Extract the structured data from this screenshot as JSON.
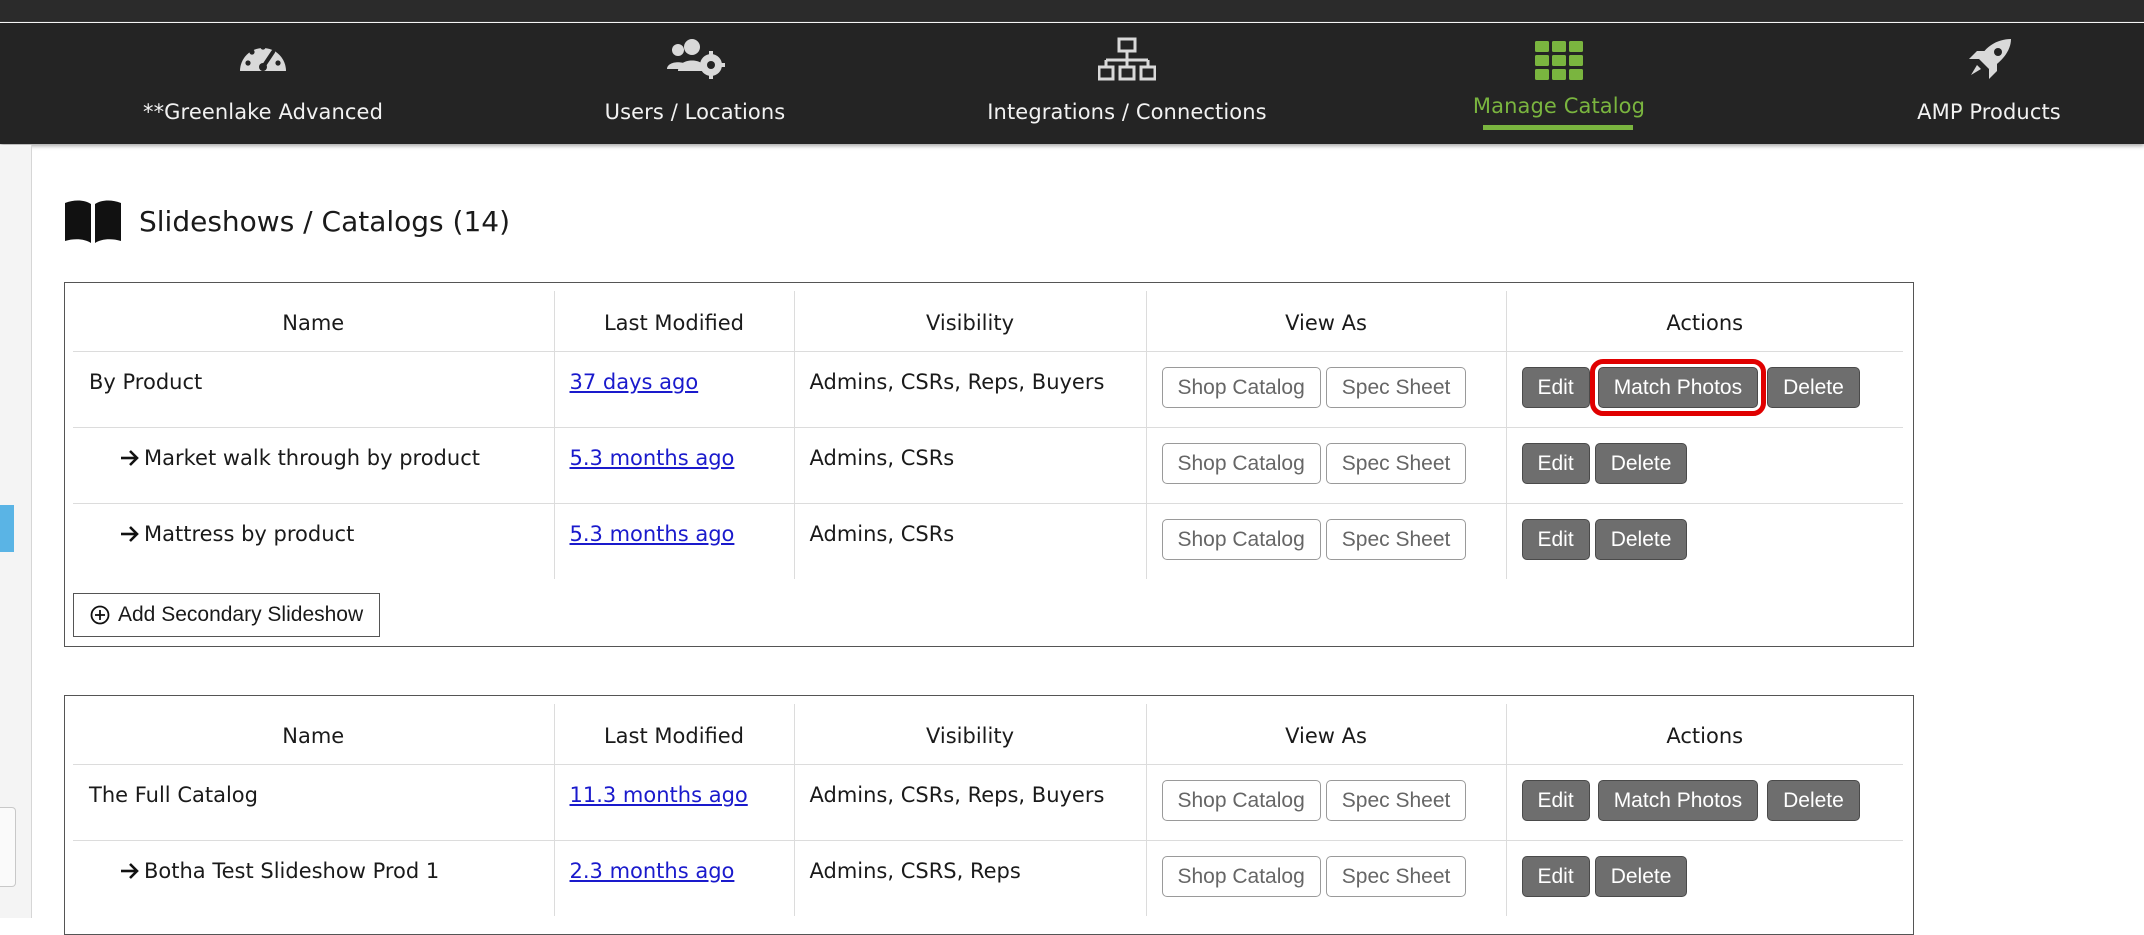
{
  "nav": {
    "items": [
      {
        "label": "**Greenlake Advanced",
        "icon": "speedometer-icon"
      },
      {
        "label": "Users / Locations",
        "icon": "users-gear-icon"
      },
      {
        "label": "Integrations / Connections",
        "icon": "network-icon"
      },
      {
        "label": "Manage Catalog",
        "icon": "grid-icon",
        "active": true
      },
      {
        "label": "AMP Products",
        "icon": "rocket-icon"
      }
    ],
    "active_color": "#7ab53f"
  },
  "page": {
    "icon": "book-icon",
    "title": "Slideshows / Catalogs (14)"
  },
  "columns": {
    "name": "Name",
    "last_modified": "Last Modified",
    "visibility": "Visibility",
    "view_as": "View As",
    "actions": "Actions"
  },
  "buttons": {
    "shop_catalog": "Shop Catalog",
    "spec_sheet": "Spec Sheet",
    "edit": "Edit",
    "match_photos": "Match Photos",
    "delete": "Delete",
    "add_secondary": "Add Secondary Slideshow"
  },
  "table1": {
    "rows": [
      {
        "name": "By Product",
        "modified": "37 days ago",
        "visibility": "Admins, CSRs, Reps, Buyers",
        "child": false
      },
      {
        "name": "Market walk through by product",
        "modified": "5.3 months ago",
        "visibility": "Admins, CSRs",
        "child": true
      },
      {
        "name": "Mattress by product",
        "modified": "5.3 months ago",
        "visibility": "Admins, CSRs",
        "child": true
      }
    ]
  },
  "table2": {
    "rows": [
      {
        "name": "The Full Catalog",
        "modified": "11.3 months ago",
        "visibility": "Admins, CSRs, Reps, Buyers",
        "child": false
      },
      {
        "name": "Botha Test Slideshow Prod 1",
        "modified": "2.3 months ago",
        "visibility": "Admins, CSRS, Reps",
        "child": true
      }
    ]
  },
  "colors": {
    "highlight": "#e00000",
    "nav_bg": "#242424",
    "link": "#1a1acc"
  }
}
